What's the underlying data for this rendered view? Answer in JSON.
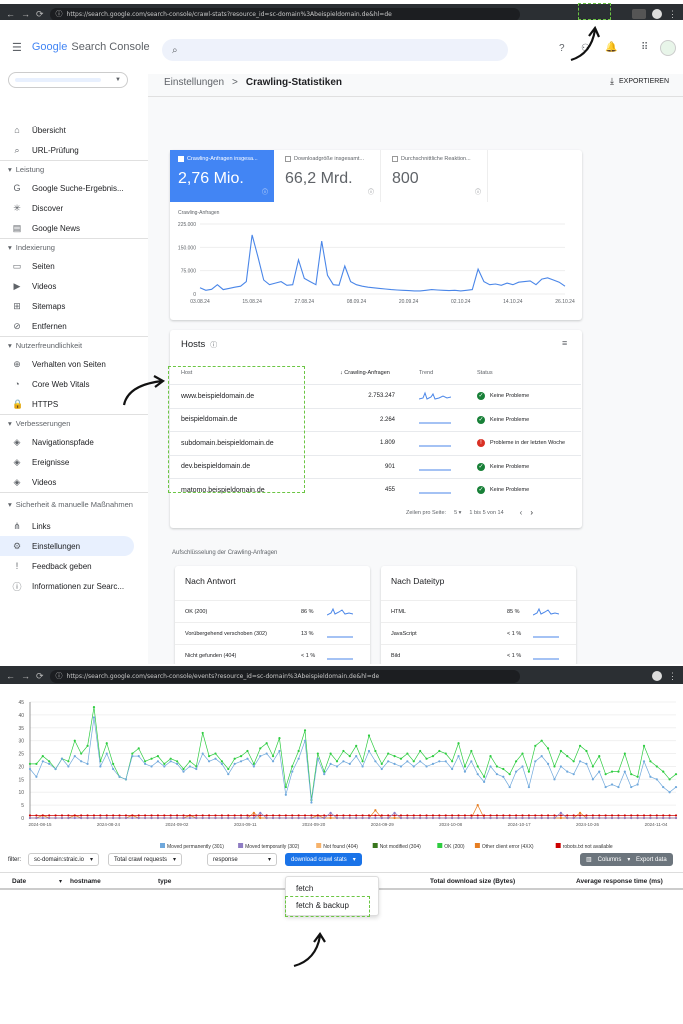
{
  "top_browser": {
    "url": "https://search.google.com/search-console/crawl-stats?resource_id=sc-domain%3Abeispieldomain.de&hl=de"
  },
  "gsc": {
    "logo": {
      "google": "Google",
      "product": "Search Console"
    },
    "breadcrumb": {
      "parent": "Einstellungen",
      "sep": ">",
      "current": "Crawling-Statistiken"
    },
    "export_label": "EXPORTIEREN",
    "sidebar": [
      {
        "type": "item",
        "icon": "home-icon",
        "glyph": "⌂",
        "label": "Übersicht"
      },
      {
        "type": "item",
        "icon": "search-icon",
        "glyph": "⌕",
        "label": "URL-Prüfung"
      },
      {
        "type": "section",
        "label": "Leistung"
      },
      {
        "type": "item",
        "icon": "google-g-icon",
        "glyph": "G",
        "label": "Google Suche-Ergebnis..."
      },
      {
        "type": "item",
        "icon": "asterisk-icon",
        "glyph": "✳",
        "label": "Discover"
      },
      {
        "type": "item",
        "icon": "news-icon",
        "glyph": "▤",
        "label": "Google News"
      },
      {
        "type": "section",
        "label": "Indexierung"
      },
      {
        "type": "item",
        "icon": "pages-icon",
        "glyph": "▭",
        "label": "Seiten"
      },
      {
        "type": "item",
        "icon": "video-icon",
        "glyph": "▶",
        "label": "Videos"
      },
      {
        "type": "item",
        "icon": "sitemap-icon",
        "glyph": "⊞",
        "label": "Sitemaps"
      },
      {
        "type": "item",
        "icon": "remove-icon",
        "glyph": "⊘",
        "label": "Entfernen"
      },
      {
        "type": "section",
        "label": "Nutzerfreundlichkeit"
      },
      {
        "type": "item",
        "icon": "plus-circle-icon",
        "glyph": "⊕",
        "label": "Verhalten von Seiten"
      },
      {
        "type": "item",
        "icon": "gauge-icon",
        "glyph": "◔",
        "label": "Core Web Vitals"
      },
      {
        "type": "item",
        "icon": "lock-icon",
        "glyph": "🔒",
        "label": "HTTPS"
      },
      {
        "type": "section",
        "label": "Verbesserungen"
      },
      {
        "type": "item",
        "icon": "layers-icon",
        "glyph": "◈",
        "label": "Navigationspfade"
      },
      {
        "type": "item",
        "icon": "layers-icon",
        "glyph": "◈",
        "label": "Ereignisse"
      },
      {
        "type": "item",
        "icon": "layers-icon",
        "glyph": "◈",
        "label": "Videos"
      },
      {
        "type": "section",
        "label": "Sicherheit & manuelle Maßnahmen"
      },
      {
        "type": "item",
        "icon": "links-icon",
        "glyph": "⋔",
        "label": "Links"
      },
      {
        "type": "item",
        "icon": "gear-icon",
        "glyph": "⚙",
        "label": "Einstellungen",
        "active": true
      },
      {
        "type": "item",
        "icon": "feedback-icon",
        "glyph": "!",
        "label": "Feedback geben"
      },
      {
        "type": "item",
        "icon": "info-icon",
        "glyph": "ⓘ",
        "label": "Informationen zur Searc..."
      }
    ],
    "tiles": [
      {
        "label": "Crawling-Anfragen insgesa...",
        "value": "2,76 Mio.",
        "active": true
      },
      {
        "label": "Downloadgröße insgesamt...",
        "value": "66,2 Mrd."
      },
      {
        "label": "Durchschnittliche Reaktion...",
        "value": "800"
      }
    ],
    "chart_data": {
      "type": "line",
      "ylabel": "Crawling-Anfragen",
      "yticks": [
        "225.000",
        "150.000",
        "75.000",
        "0"
      ],
      "ylim": [
        0,
        225000
      ],
      "x": [
        "03.08.24",
        "15.08.24",
        "27.08.24",
        "08.09.24",
        "20.09.24",
        "02.10.24",
        "14.10.24",
        "26.10.24"
      ],
      "series": [
        {
          "values": [
            20000,
            12000,
            15000,
            30000,
            14000,
            18000,
            22000,
            25000,
            40000,
            190000,
            120000,
            45000,
            30000,
            35000,
            40000,
            28000,
            30000,
            110000,
            50000,
            40000,
            30000,
            170000,
            60000,
            30000,
            28000,
            90000,
            40000,
            30000,
            25000,
            22000,
            20000,
            18000,
            16000,
            14000,
            13000,
            12000,
            11000,
            10000,
            10000,
            12000,
            14000,
            13000,
            12000,
            11000,
            12000,
            10000,
            12000,
            14000,
            80000,
            40000,
            30000,
            32000,
            28000,
            35000,
            30000,
            38000,
            40000,
            42000,
            30000,
            48000,
            52000,
            45000,
            38000,
            25000
          ]
        }
      ],
      "color": "#4a86e8"
    },
    "hosts": {
      "title": "Hosts",
      "col_host": "Host",
      "col_req": "Crawling-Anfragen",
      "col_trend": "Trend",
      "col_status": "Status",
      "rows": [
        {
          "host": "www.beispieldomain.de",
          "req": "2.753.247",
          "status": "Keine Probleme",
          "ok": true
        },
        {
          "host": "beispieldomain.de",
          "req": "2.264",
          "status": "Keine Probleme",
          "ok": true
        },
        {
          "host": "subdomain.beispieldomain.de",
          "req": "1.809",
          "status": "Probleme in der letzten Woche",
          "ok": false
        },
        {
          "host": "dev.beispieldomain.de",
          "req": "901",
          "status": "Keine Probleme",
          "ok": true
        },
        {
          "host": "matomo.beispieldomain.de",
          "req": "455",
          "status": "Keine Probleme",
          "ok": true
        }
      ],
      "rows_per_page_label": "Zeilen pro Seite:",
      "rows_per_page": "5",
      "range": "1 bis 5 von 14"
    },
    "breakdown_title": "Aufschlüsselung der Crawling-Anfragen",
    "by_response": {
      "title": "Nach Antwort",
      "rows": [
        {
          "label": "OK (200)",
          "pct": "86 %"
        },
        {
          "label": "Vorübergehend verschoben (302)",
          "pct": "13 %"
        },
        {
          "label": "Nicht gefunden (404)",
          "pct": "< 1 %"
        }
      ]
    },
    "by_filetype": {
      "title": "Nach Dateityp",
      "rows": [
        {
          "label": "HTML",
          "pct": "85 %"
        },
        {
          "label": "JavaScript",
          "pct": "< 1 %"
        },
        {
          "label": "Bild",
          "pct": "< 1 %"
        }
      ]
    }
  },
  "bottom_browser": {
    "url": "https://search.google.com/search-console/events?resource_id=sc-domain%3Abeispieldomain.de&hl=de"
  },
  "events": {
    "yticks": [
      "45",
      "40",
      "35",
      "30",
      "25",
      "20",
      "15",
      "10",
      "5",
      "0"
    ],
    "xticks": [
      "2024-08-15",
      "2024-08-24",
      "2024-09-02",
      "2024-09-11",
      "2024-09-20",
      "2024-09-29",
      "2024-10-08",
      "2024-10-17",
      "2024-10-26",
      "2024-11-04"
    ],
    "legend": [
      {
        "label": "Moved permanently (301)",
        "color": "#6fa8dc"
      },
      {
        "label": "Moved temporarily (302)",
        "color": "#8e7cc3"
      },
      {
        "label": "Not found (404)",
        "color": "#f6b26b"
      },
      {
        "label": "Not modified (304)",
        "color": "#38761d"
      },
      {
        "label": "OK (200)",
        "color": "#2ecc40"
      },
      {
        "label": "Other client error (4XX)",
        "color": "#e67e22"
      },
      {
        "label": "robots.txt not available",
        "color": "#cc0000"
      }
    ],
    "chart_data": {
      "type": "line",
      "ylim": [
        0,
        45
      ],
      "series": [
        {
          "name": "OK (200)",
          "color": "#2ecc40",
          "values": [
            21,
            21,
            24,
            22,
            19,
            23,
            22,
            30,
            25,
            28,
            43,
            22,
            29,
            21,
            16,
            15,
            25,
            27,
            22,
            23,
            24,
            21,
            23,
            22,
            19,
            22,
            20,
            33,
            24,
            25,
            22,
            19,
            23,
            24,
            26,
            21,
            27,
            29,
            24,
            31,
            12,
            20,
            26,
            34,
            7,
            25,
            18,
            25,
            22,
            26,
            24,
            28,
            22,
            32,
            26,
            21,
            25,
            24,
            23,
            25,
            22,
            26,
            23,
            24,
            26,
            25,
            22,
            29,
            20,
            26,
            20,
            16,
            24,
            20,
            19,
            17,
            22,
            25,
            18,
            28,
            30,
            27,
            20,
            26,
            24,
            22,
            28,
            26,
            20,
            24,
            17,
            18,
            18,
            25,
            17,
            16,
            28,
            22,
            20,
            18,
            15,
            17
          ]
        },
        {
          "name": "Moved permanently (301)",
          "color": "#6fa8dc",
          "values": [
            19,
            16,
            22,
            21,
            19,
            23,
            20,
            24,
            22,
            21,
            39,
            20,
            25,
            19,
            16,
            15,
            24,
            24,
            21,
            20,
            22,
            20,
            22,
            21,
            18,
            20,
            19,
            25,
            22,
            23,
            21,
            17,
            21,
            22,
            23,
            20,
            24,
            25,
            22,
            26,
            9,
            18,
            23,
            30,
            6,
            23,
            17,
            21,
            20,
            22,
            21,
            24,
            20,
            26,
            22,
            19,
            22,
            21,
            20,
            22,
            20,
            22,
            20,
            21,
            22,
            22,
            19,
            24,
            18,
            22,
            17,
            14,
            20,
            17,
            16,
            12,
            18,
            20,
            12,
            22,
            24,
            21,
            15,
            20,
            18,
            17,
            22,
            21,
            15,
            18,
            12,
            13,
            12,
            18,
            12,
            13,
            22,
            16,
            15,
            12,
            10,
            12
          ]
        },
        {
          "name": "Other client error (4XX)",
          "color": "#e67e22",
          "values": [
            0,
            0,
            1,
            0,
            0,
            0,
            0,
            1,
            0,
            0,
            0,
            0,
            0,
            0,
            0,
            0,
            1,
            0,
            0,
            0,
            0,
            0,
            0,
            0,
            0,
            1,
            0,
            0,
            0,
            0,
            0,
            0,
            0,
            0,
            0,
            2,
            0,
            0,
            0,
            0,
            0,
            0,
            0,
            0,
            0,
            1,
            0,
            0,
            0,
            0,
            0,
            0,
            0,
            0,
            3,
            0,
            0,
            0,
            0,
            0,
            0,
            0,
            0,
            0,
            0,
            0,
            0,
            0,
            0,
            0,
            5,
            0,
            0,
            0,
            0,
            0,
            0,
            0,
            0,
            0,
            0,
            0,
            0,
            0,
            0,
            0,
            2,
            0,
            0,
            0,
            0,
            0,
            0,
            0,
            0,
            0,
            0,
            0,
            0,
            0,
            0,
            0
          ]
        },
        {
          "name": "robots.txt not available",
          "color": "#cc0000",
          "values": [
            1,
            1,
            1,
            1,
            1,
            1,
            1,
            1,
            1,
            1,
            1,
            1,
            1,
            1,
            1,
            1,
            1,
            1,
            1,
            1,
            1,
            1,
            1,
            1,
            1,
            1,
            1,
            1,
            1,
            1,
            1,
            1,
            1,
            1,
            1,
            1,
            1,
            1,
            1,
            1,
            1,
            1,
            1,
            1,
            1,
            1,
            1,
            1,
            1,
            1,
            1,
            1,
            1,
            1,
            1,
            1,
            1,
            1,
            1,
            1,
            1,
            1,
            1,
            1,
            1,
            1,
            1,
            1,
            1,
            1,
            1,
            1,
            1,
            1,
            1,
            1,
            1,
            1,
            1,
            1,
            1,
            1,
            1,
            1,
            1,
            1,
            1,
            1,
            1,
            1,
            1,
            1,
            1,
            1,
            1,
            1,
            1,
            1,
            1,
            1,
            1,
            1
          ]
        },
        {
          "name": "Moved temporarily (302)",
          "color": "#8e7cc3",
          "values": [
            0,
            0,
            0,
            0,
            0,
            0,
            0,
            0,
            0,
            0,
            0,
            0,
            0,
            0,
            0,
            0,
            0,
            0,
            0,
            0,
            0,
            0,
            0,
            0,
            0,
            0,
            0,
            0,
            0,
            0,
            0,
            0,
            0,
            0,
            0,
            0,
            2,
            0,
            0,
            0,
            0,
            0,
            0,
            0,
            0,
            0,
            0,
            2,
            0,
            0,
            0,
            0,
            0,
            0,
            0,
            0,
            0,
            2,
            0,
            0,
            0,
            0,
            0,
            0,
            0,
            0,
            0,
            0,
            0,
            0,
            0,
            0,
            0,
            0,
            0,
            0,
            0,
            0,
            0,
            0,
            0,
            0,
            0,
            2,
            0,
            0,
            0,
            0,
            0,
            0,
            0,
            0,
            0,
            0,
            0,
            0,
            0,
            0,
            0,
            0,
            0,
            0
          ]
        }
      ]
    },
    "toolbar": {
      "filter_label": "filter:",
      "domain": "sc-domain:straic.io",
      "metric": "Total crawl requests",
      "dimension": "response",
      "download": "download crawl stats",
      "columns": "Columns",
      "export": "Export data"
    },
    "table_headers": [
      "Date",
      "hostname",
      "type",
      "Total download size (Bytes)",
      "Average response time (ms)"
    ],
    "dropdown": [
      "fetch",
      "fetch & backup"
    ]
  }
}
